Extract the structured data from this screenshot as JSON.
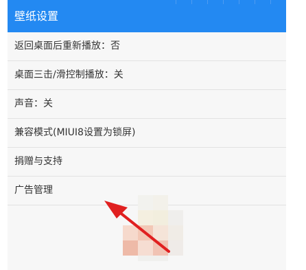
{
  "header": {
    "title": "壁纸设置"
  },
  "settings": {
    "items": [
      {
        "label": "返回桌面后重新播放：否"
      },
      {
        "label": "桌面三击/滑控制播放：关"
      },
      {
        "label": "声音：关"
      },
      {
        "label": "兼容模式(MIUI8设置为锁屏)"
      },
      {
        "label": "捐赠与支持"
      },
      {
        "label": "广告管理"
      }
    ]
  },
  "colors": {
    "header_bg": "#2389f2",
    "list_bg": "#f7f7f7",
    "arrow": "#e02020"
  }
}
